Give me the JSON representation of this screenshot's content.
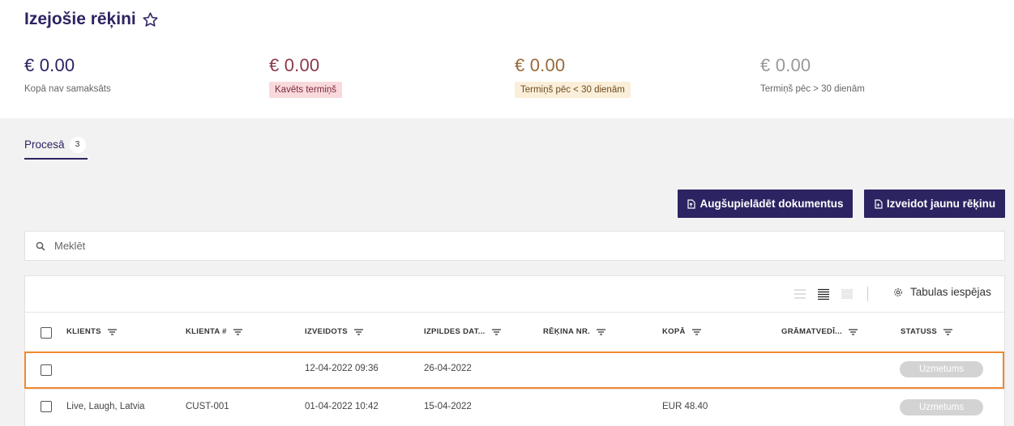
{
  "page": {
    "title": "Izejošie rēķini"
  },
  "summary": [
    {
      "amount": "€ 0.00",
      "label": "Kopā nav samaksāts"
    },
    {
      "amount": "€ 0.00",
      "label": "Kavēts termiņš"
    },
    {
      "amount": "€ 0.00",
      "label": "Termiņš pēc < 30 dienām"
    },
    {
      "amount": "€ 0.00",
      "label": "Termiņš pēc > 30 dienām"
    }
  ],
  "tabs": [
    {
      "label": "Procesā",
      "count": "3"
    }
  ],
  "actions": {
    "upload_label": "Augšupielādēt dokumentus",
    "new_label": "Izveidot jaunu rēķinu"
  },
  "search": {
    "placeholder": "Meklēt",
    "value": ""
  },
  "table": {
    "options_label": "Tabulas iespējas",
    "columns": [
      "KLIENTS",
      "KLIENTA #",
      "IZVEIDOTS",
      "IZPILDES DAT...",
      "RĒĶINA NR.",
      "KOPĀ",
      "GRĀMATVEDĪ...",
      "STATUSS"
    ],
    "rows": [
      {
        "client": "",
        "client_no": "",
        "created": "12-04-2022 09:36",
        "due": "26-04-2022",
        "invoice_no": "",
        "total": "",
        "accountant": "",
        "status": "Uzmetums"
      },
      {
        "client": "Live, Laugh, Latvia",
        "client_no": "CUST-001",
        "created": "01-04-2022 10:42",
        "due": "15-04-2022",
        "invoice_no": "",
        "total": "EUR 48.40",
        "accountant": "",
        "status": "Uzmetums"
      }
    ]
  },
  "icons": {
    "star": "star-icon",
    "upload": "file-upload-icon",
    "new": "file-new-icon",
    "search": "search-icon",
    "filter": "filter-icon",
    "density": [
      "density-comfortable-icon",
      "density-standard-icon",
      "density-compact-icon"
    ],
    "settings": "settings-icon"
  },
  "colors": {
    "primary": "#2c2462",
    "overdue": "#f9d9dc",
    "soon": "#fbefd9",
    "highlight": "#f0892f",
    "status_draft": "#d3d3d3"
  }
}
